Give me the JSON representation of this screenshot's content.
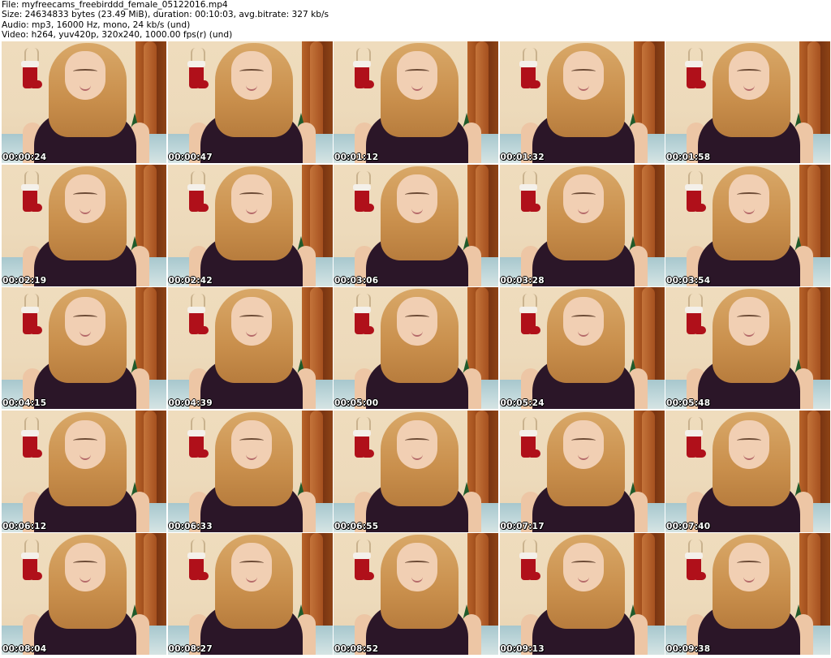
{
  "header": {
    "file": "File: myfreecams_freebirddd_female_05122016.mp4",
    "size": "Size: 24634833 bytes (23.49 MiB), duration: 00:10:03, avg.bitrate: 327 kb/s",
    "audio": "Audio: mp3, 16000 Hz, mono, 24 kb/s (und)",
    "video": "Video: h264, yuv420p, 320x240, 1000.00 fps(r) (und)"
  },
  "thumbnails": [
    {
      "timestamp": "00:00:24"
    },
    {
      "timestamp": "00:00:47"
    },
    {
      "timestamp": "00:01:12"
    },
    {
      "timestamp": "00:01:32"
    },
    {
      "timestamp": "00:01:58"
    },
    {
      "timestamp": "00:02:19"
    },
    {
      "timestamp": "00:02:42"
    },
    {
      "timestamp": "00:03:06"
    },
    {
      "timestamp": "00:03:28"
    },
    {
      "timestamp": "00:03:54"
    },
    {
      "timestamp": "00:04:15"
    },
    {
      "timestamp": "00:04:39"
    },
    {
      "timestamp": "00:05:00"
    },
    {
      "timestamp": "00:05:24"
    },
    {
      "timestamp": "00:05:48"
    },
    {
      "timestamp": "00:06:12"
    },
    {
      "timestamp": "00:06:33"
    },
    {
      "timestamp": "00:06:55"
    },
    {
      "timestamp": "00:07:17"
    },
    {
      "timestamp": "00:07:40"
    },
    {
      "timestamp": "00:08:04"
    },
    {
      "timestamp": "00:08:27"
    },
    {
      "timestamp": "00:08:52"
    },
    {
      "timestamp": "00:09:13"
    },
    {
      "timestamp": "00:09:38"
    }
  ],
  "colors": {
    "background": "#ffffff",
    "timestamp_text": "#ffffff",
    "timestamp_outline": "#000000"
  }
}
